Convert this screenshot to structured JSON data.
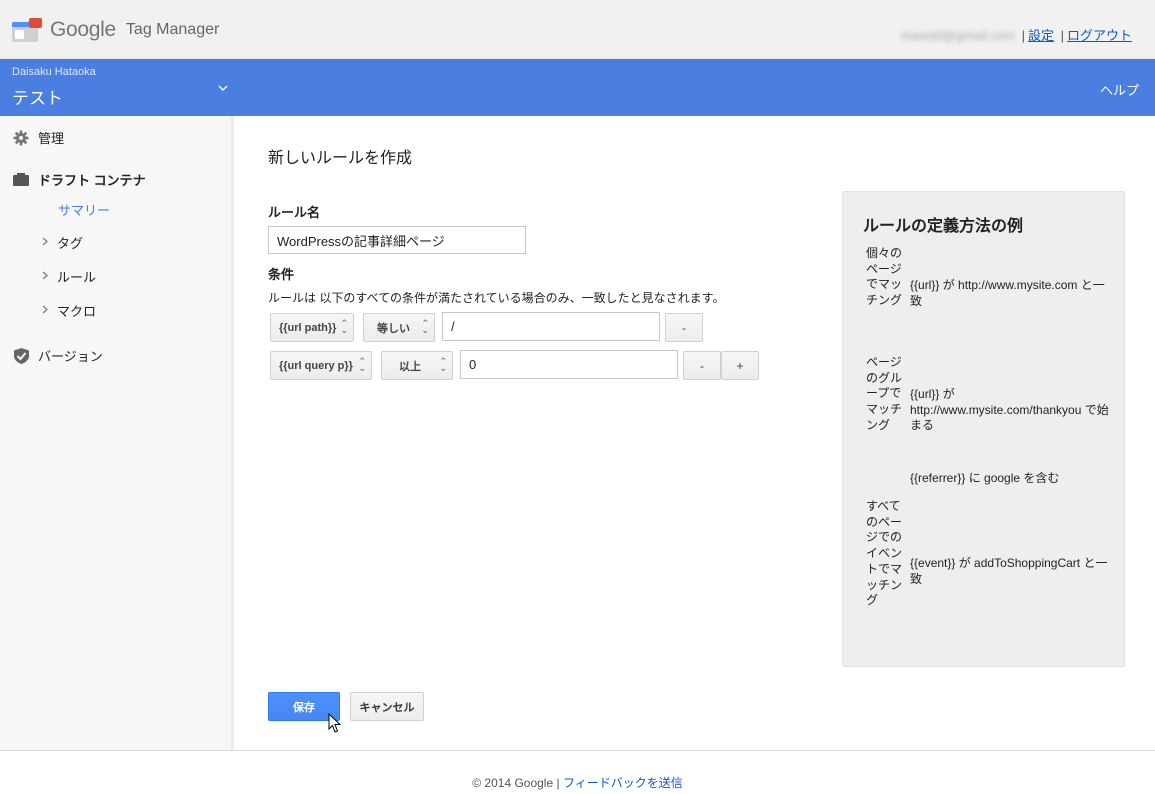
{
  "header": {
    "logo_google": "Google",
    "logo_product": "Tag Manager",
    "email": "mawdd@gmail.com",
    "separator": "|",
    "settings_link": "設定",
    "logout_link": "ログアウト"
  },
  "container_bar": {
    "owner": "Daisaku Hataoka",
    "container_name": "テスト",
    "help": "ヘルプ"
  },
  "sidebar": {
    "admin": "管理",
    "draft_container": "ドラフト コンテナ",
    "summary": "サマリー",
    "tags": "タグ",
    "rules": "ルール",
    "macros": "マクロ",
    "versions": "バージョン"
  },
  "main": {
    "title": "新しいルールを作成",
    "rule_name_label": "ルール名",
    "rule_name_value": "WordPressの記事詳細ページ",
    "conditions_label": "条件",
    "conditions_desc": "ルールは 以下のすべての条件が満たされている場合のみ、一致したと見なされます。",
    "conditions": [
      {
        "macro": "{{url path}}",
        "operator": "等しい",
        "value": "/"
      },
      {
        "macro": "{{url query p}}",
        "operator": "以上",
        "value": "0"
      }
    ],
    "remove_label": "-",
    "add_label": "+",
    "save_button": "保存",
    "cancel_button": "キャンセル"
  },
  "examples": {
    "title": "ルールの定義方法の例",
    "items": [
      {
        "category": "個々のページでマッチング",
        "rule": "{{url}} が http://www.mysite.com と一致"
      },
      {
        "category": "ページのグループでマッチング",
        "rule": "{{url}} が http://www.mysite.com/thankyou で始まる"
      },
      {
        "category": "",
        "rule": "{{referrer}} に google を含む"
      },
      {
        "category": "すべてのページでのイベントでマッチング",
        "rule": "{{event}} が addToShoppingCart と一致"
      }
    ]
  },
  "footer": {
    "copyright": "© 2014 Google",
    "separator": "|",
    "feedback": "フィードバックを送信"
  },
  "colors": {
    "blue_bar": "#4a7ee0",
    "link": "#1155cc",
    "primary_button": "#4d90fe"
  }
}
